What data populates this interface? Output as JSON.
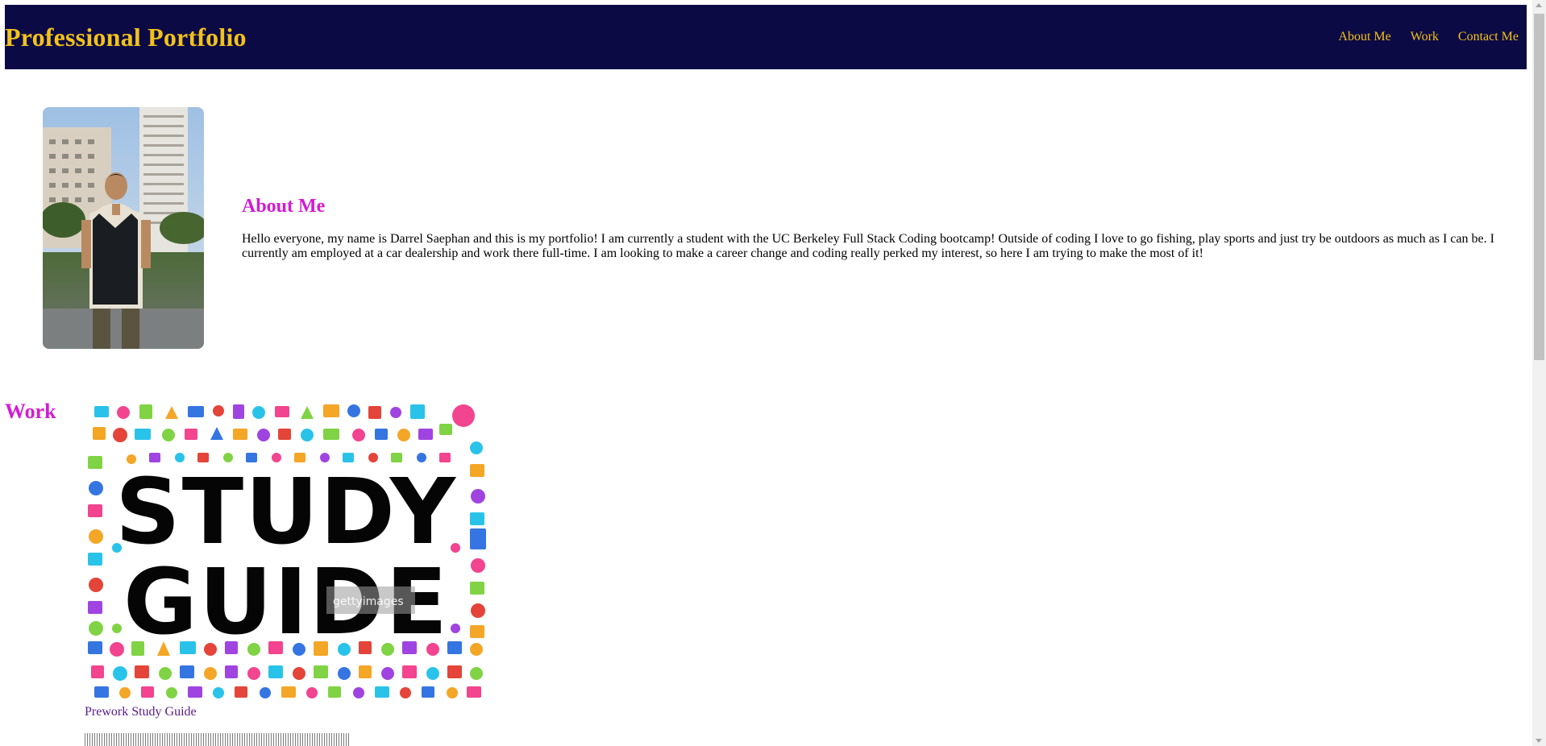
{
  "header": {
    "title": "Professional Portfolio",
    "nav": [
      {
        "label": "About Me"
      },
      {
        "label": "Work"
      },
      {
        "label": "Contact Me"
      }
    ],
    "background_color": "#0c0a45",
    "text_color": "#f2c21a"
  },
  "about": {
    "heading": "About Me",
    "body": "Hello everyone, my name is Darrel Saephan and this is my portfolio! I am currently a student with the UC Berkeley Full Stack Coding bootcamp! Outside of coding I love to go fishing, play sports and just try be outdoors as much as I can be. I currently am employed at a car dealership and work there full-time. I am looking to make a career change and coding really perked my interest, so here I am trying to make the most of it!",
    "heading_color": "#d41bd4"
  },
  "work": {
    "heading": "Work",
    "items": [
      {
        "image_text": "STUDY GUIDE",
        "watermark": "gettyimages",
        "link_label": "Prework Study Guide"
      }
    ]
  }
}
